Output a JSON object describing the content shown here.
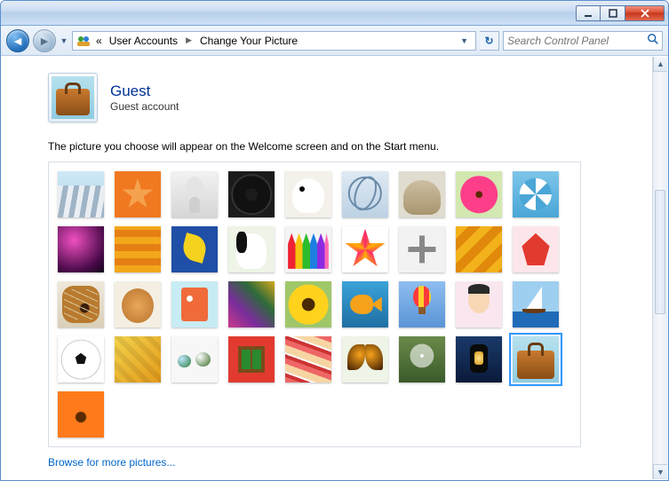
{
  "titlebar": {
    "minimize": "–",
    "maximize": "▢",
    "close": "✕"
  },
  "nav": {
    "back_label": "Back",
    "forward_label": "Forward",
    "refresh": "↻"
  },
  "breadcrumb": {
    "prefix": "«",
    "seg1": "User Accounts",
    "seg2": "Change Your Picture"
  },
  "search": {
    "placeholder": "Search Control Panel"
  },
  "user": {
    "name": "Guest",
    "type": "Guest account",
    "current_picture": "suitcase"
  },
  "instruction": "The picture you choose will appear on the Welcome screen and on the Start menu.",
  "selected_picture": "suitcase",
  "pictures": [
    {
      "id": "rollercoaster",
      "label": "Roller coaster"
    },
    {
      "id": "starfish",
      "label": "Starfish"
    },
    {
      "id": "alien",
      "label": "Alien"
    },
    {
      "id": "record",
      "label": "Vinyl record"
    },
    {
      "id": "luckycat",
      "label": "Lucky cat"
    },
    {
      "id": "gyroscope",
      "label": "Gyroscope"
    },
    {
      "id": "kitten",
      "label": "Kitten"
    },
    {
      "id": "pinkflower",
      "label": "Pink flower"
    },
    {
      "id": "pinwheel",
      "label": "Pinwheel"
    },
    {
      "id": "ball",
      "label": "Bowling ball"
    },
    {
      "id": "plaid",
      "label": "Plaid"
    },
    {
      "id": "ginkgo",
      "label": "Ginkgo leaf"
    },
    {
      "id": "bordercollie",
      "label": "Border collie"
    },
    {
      "id": "crayons",
      "label": "Crayons"
    },
    {
      "id": "starburst",
      "label": "Starburst"
    },
    {
      "id": "jacks",
      "label": "Jacks"
    },
    {
      "id": "stairs",
      "label": "Stairs"
    },
    {
      "id": "origami",
      "label": "Origami crane"
    },
    {
      "id": "guitar",
      "label": "Guitar"
    },
    {
      "id": "pomeranian",
      "label": "Pomeranian"
    },
    {
      "id": "robot",
      "label": "Robot"
    },
    {
      "id": "fabric",
      "label": "Fabric"
    },
    {
      "id": "sunflower",
      "label": "Sunflower"
    },
    {
      "id": "fish",
      "label": "Fish"
    },
    {
      "id": "balloon",
      "label": "Hot-air balloon"
    },
    {
      "id": "doll",
      "label": "Kokeshi doll"
    },
    {
      "id": "sailboat",
      "label": "Sailboat"
    },
    {
      "id": "soccer",
      "label": "Soccer ball"
    },
    {
      "id": "tile",
      "label": "Tile"
    },
    {
      "id": "marbles",
      "label": "Marbles"
    },
    {
      "id": "window",
      "label": "Window"
    },
    {
      "id": "textile",
      "label": "Textile"
    },
    {
      "id": "butterfly",
      "label": "Butterfly"
    },
    {
      "id": "dandelion",
      "label": "Dandelion"
    },
    {
      "id": "lantern",
      "label": "Lantern"
    },
    {
      "id": "suitcase",
      "label": "Suitcase"
    },
    {
      "id": "gerbera",
      "label": "Gerbera"
    }
  ],
  "picture_class_map": {
    "rollercoaster": "pic-coaster",
    "starfish": "pic-starfish",
    "alien": "pic-alien",
    "record": "pic-record",
    "luckycat": "pic-cat",
    "gyroscope": "pic-gyro",
    "kitten": "pic-kitten",
    "pinkflower": "pic-pinkflower",
    "pinwheel": "pic-pinwheel",
    "ball": "pic-ball",
    "plaid": "pic-plaid",
    "ginkgo": "pic-leaf",
    "bordercollie": "pic-dog",
    "crayons": "pic-crayons",
    "starburst": "pic-burst",
    "jacks": "pic-jacks",
    "stairs": "pic-stairs",
    "origami": "pic-origami",
    "guitar": "pic-guitar",
    "pomeranian": "pic-pom",
    "robot": "pic-robot",
    "fabric": "pic-fabric",
    "sunflower": "pic-sunflower",
    "fish": "pic-fish",
    "balloon": "pic-balloon",
    "doll": "pic-doll",
    "sailboat": "pic-sailboat",
    "soccer": "pic-soccer",
    "tile": "pic-tile",
    "marbles": "pic-marbles",
    "window": "pic-window",
    "textile": "pic-textile",
    "butterfly": "pic-butterfly",
    "dandelion": "pic-dandelion",
    "lantern": "pic-lantern",
    "suitcase": "pic-suitcase",
    "gerbera": "pic-gerbera"
  },
  "browse_link": "Browse for more pictures..."
}
